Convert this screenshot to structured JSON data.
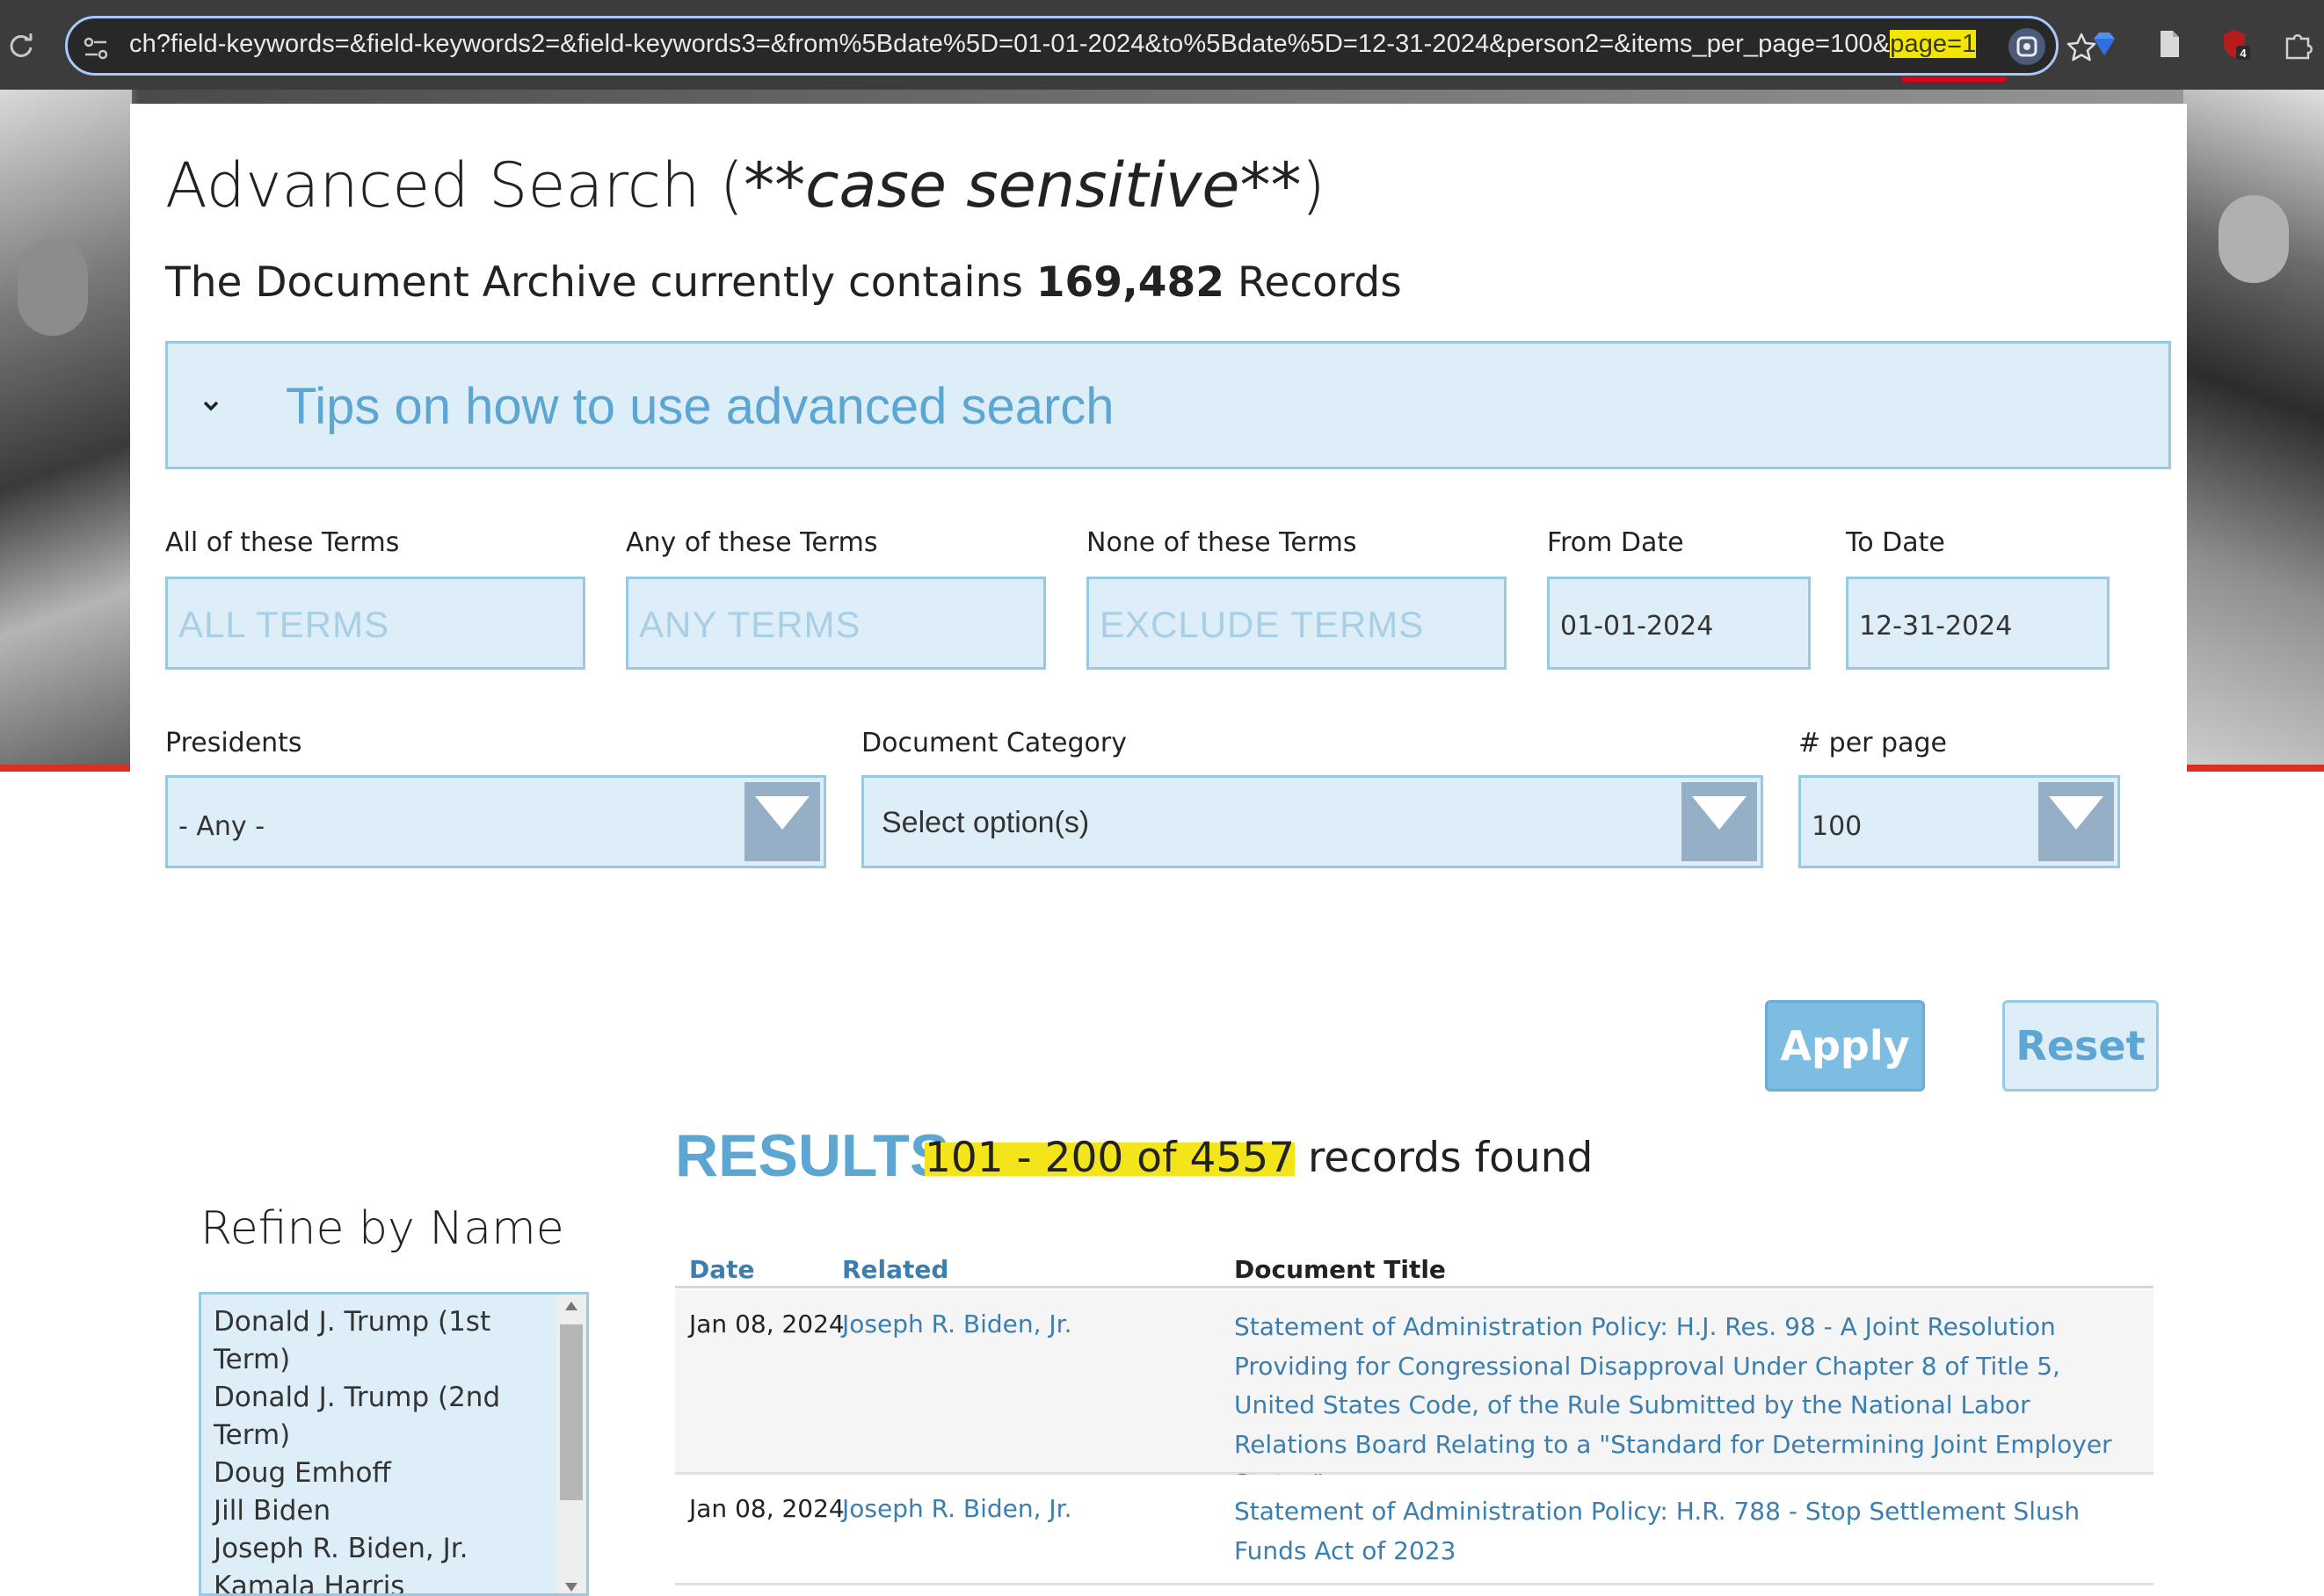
{
  "browser": {
    "url_prefix": "ch?field-keywords=&field-keywords2=&field-keywords3=&from%5Bdate%5D=01-01-2024&to%5Bdate%5D=12-31-2024&person2=&items_per_page=100&",
    "url_highlight": "page=1",
    "extension_badge": "4"
  },
  "page": {
    "title_main": "Advanced Search (",
    "title_italic": "**case sensitive**",
    "title_end": ")",
    "archive_prefix": "The Document Archive currently contains ",
    "archive_count": "169,482",
    "archive_suffix": " Records",
    "tips_label": "Tips on how to use advanced search"
  },
  "form": {
    "all_terms": {
      "label": "All of these Terms",
      "placeholder": "ALL TERMS"
    },
    "any_terms": {
      "label": "Any of these Terms",
      "placeholder": "ANY TERMS"
    },
    "none_terms": {
      "label": "None of these Terms",
      "placeholder": "EXCLUDE TERMS"
    },
    "from_date": {
      "label": "From Date",
      "value": "01-01-2024"
    },
    "to_date": {
      "label": "To Date",
      "value": "12-31-2024"
    },
    "presidents": {
      "label": "Presidents",
      "value": "- Any -"
    },
    "category": {
      "label": "Document Category",
      "value": "Select option(s)"
    },
    "per_page": {
      "label": "# per page",
      "value": "100"
    },
    "apply_label": "Apply",
    "reset_label": "Reset"
  },
  "results": {
    "label": "RESULTS",
    "range": "101 - 200 of 4557",
    "suffix": " records found"
  },
  "refine": {
    "title": "Refine by Name",
    "names": [
      "Donald J. Trump (1st Term)",
      "Donald J. Trump (2nd Term)",
      "Doug Emhoff",
      "Jill Biden",
      "Joseph R. Biden, Jr.",
      "Kamala Harris"
    ]
  },
  "table": {
    "headers": {
      "date": "Date",
      "related": "Related",
      "title": "Document Title"
    },
    "rows": [
      {
        "date": "Jan 08, 2024",
        "related": "Joseph R. Biden, Jr.",
        "title": "Statement of Administration Policy: H.J. Res. 98 - A Joint Resolution Providing for Congressional Disapproval Under Chapter 8 of Title 5, United States Code, of the Rule Submitted by the National Labor Relations Board Relating to a \"Standard for Determining Joint Employer Status\""
      },
      {
        "date": "Jan 08, 2024",
        "related": "Joseph R. Biden, Jr.",
        "title": "Statement of Administration Policy: H.R. 788 - Stop Settlement Slush Funds Act of 2023"
      }
    ]
  },
  "colors": {
    "accent": "#5ba6d3",
    "link": "#3b7eb0",
    "field_bg": "#ddeef8",
    "field_border": "#99c8e4",
    "highlight": "#f4e51b",
    "banner_red": "#d9301f"
  }
}
